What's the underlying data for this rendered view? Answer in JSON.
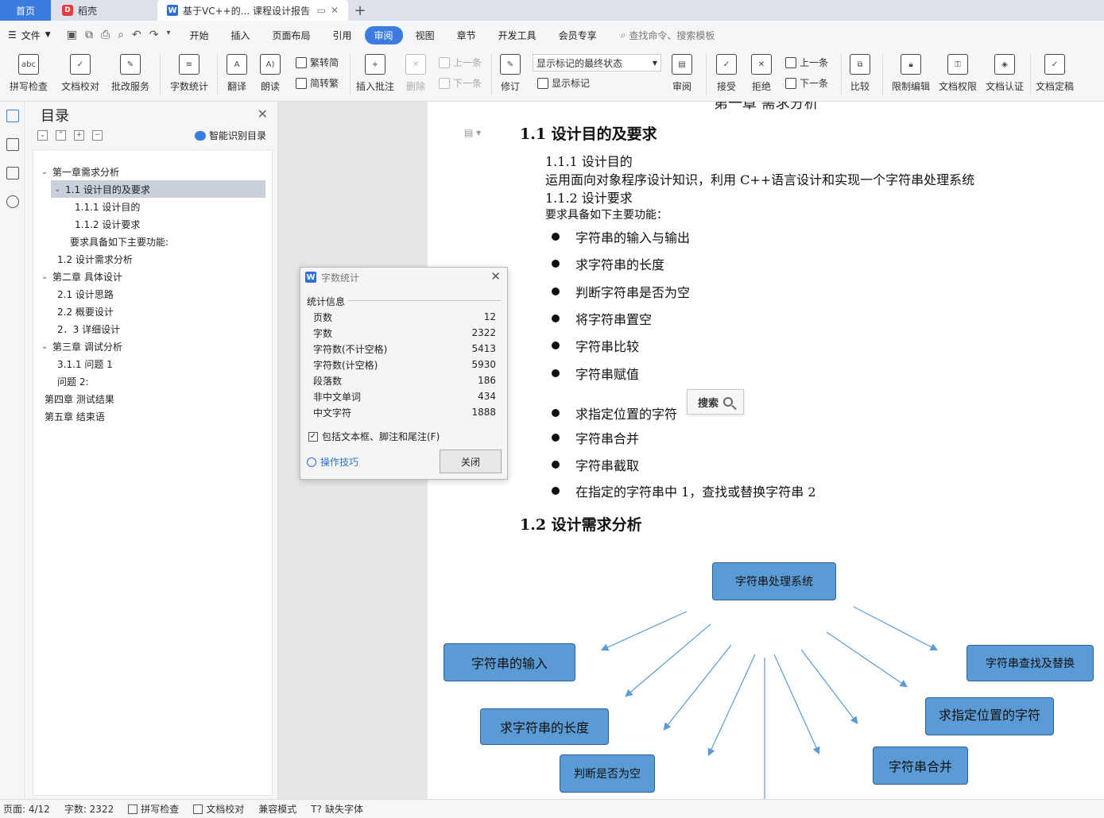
{
  "tabs": {
    "home": "首页",
    "daoke": "稻壳",
    "doc": "基于VC++的... 课程设计报告"
  },
  "menubar": {
    "file": "文件",
    "items": [
      "开始",
      "插入",
      "页面布局",
      "引用",
      "审阅",
      "视图",
      "章节",
      "开发工具",
      "会员专享"
    ],
    "active_index": 4,
    "search_placeholder": "查找命令、搜索模板"
  },
  "ribbon": {
    "spell": "拼写检查",
    "doc_check": "文档校对",
    "revise_service": "批改服务",
    "word_count": "字数统计",
    "translate": "翻译",
    "read_aloud": "朗读",
    "trad_conv": "繁转简",
    "simp_conv": "简转繁",
    "insert_comment": "插入批注",
    "delete": "删除",
    "prev": "上一条",
    "next": "下一条",
    "revise": "修订",
    "track_state": "显示标记的最终状态",
    "show_marks": "显示标记",
    "review": "审阅",
    "accept": "接受",
    "reject": "拒绝",
    "prev2": "上一条",
    "next2": "下一条",
    "compare": "比较",
    "restrict": "限制编辑",
    "doc_perm": "文档权限",
    "doc_cert": "文档认证",
    "doc_final": "文档定稿"
  },
  "toc": {
    "title": "目录",
    "smart": "智能识别目录",
    "items": [
      "第一章需求分析",
      "1.1 设计目的及要求",
      "1.1.1 设计目的",
      "1.1.2 设计要求",
      "要求具备如下主要功能:",
      "1.2 设计需求分析",
      "第二章 具体设计",
      "2.1 设计思路",
      "2.2 概要设计",
      "2．3 详细设计",
      "第三章 调试分析",
      "3.1.1 问题 1",
      "问题 2:",
      "第四章 测试结果",
      "第五章 结束语"
    ]
  },
  "doc": {
    "top_fragment": "第一章 需求分析",
    "h_1_1": "1.1 设计目的及要求",
    "h_1_1_1": "1.1.1 设计目的",
    "p_purpose": "运用面向对象程序设计知识，利用 C++语言设计和实现一个字符串处理系统",
    "h_1_1_2": "1.1.2 设计要求",
    "p_req": "要求具备如下主要功能：",
    "bullets": [
      "字符串的输入与输出",
      "求字符串的长度",
      "判断字符串是否为空",
      "将字符串置空",
      "字符串比较",
      "字符串赋值",
      "求指定位置的字符",
      "字符串合并",
      "字符串截取",
      "在指定的字符串中 1，查找或替换字符串 2"
    ],
    "h_1_2": "1.2 设计需求分析",
    "search_pop": "搜索",
    "diagram": {
      "root": "字符串处理系统",
      "input": "字符串的输入",
      "length": "求字符串的长度",
      "empty": "判断是否为空",
      "find_replace": "字符串查找及替换",
      "char_at": "求指定位置的字符",
      "merge": "字符串合并"
    }
  },
  "dialog": {
    "title": "字数统计",
    "section": "统计信息",
    "rows": [
      {
        "label": "页数",
        "value": "12"
      },
      {
        "label": "字数",
        "value": "2322"
      },
      {
        "label": "字符数(不计空格)",
        "value": "5413"
      },
      {
        "label": "字符数(计空格)",
        "value": "5930"
      },
      {
        "label": "段落数",
        "value": "186"
      },
      {
        "label": "非中文单词",
        "value": "434"
      },
      {
        "label": "中文字符",
        "value": "1888"
      }
    ],
    "include": "包括文本框、脚注和尾注(F)",
    "tips": "操作技巧",
    "close": "关闭"
  },
  "status": {
    "page": "页面: 4/12",
    "words": "字数: 2322",
    "spell": "拼写检查",
    "check": "文档校对",
    "compat": "兼容模式",
    "font_missing": "缺失字体"
  },
  "colors": {
    "accent": "#3c7be0",
    "diagram_fill": "#5b9bd5",
    "diagram_border": "#2f5f8f"
  }
}
